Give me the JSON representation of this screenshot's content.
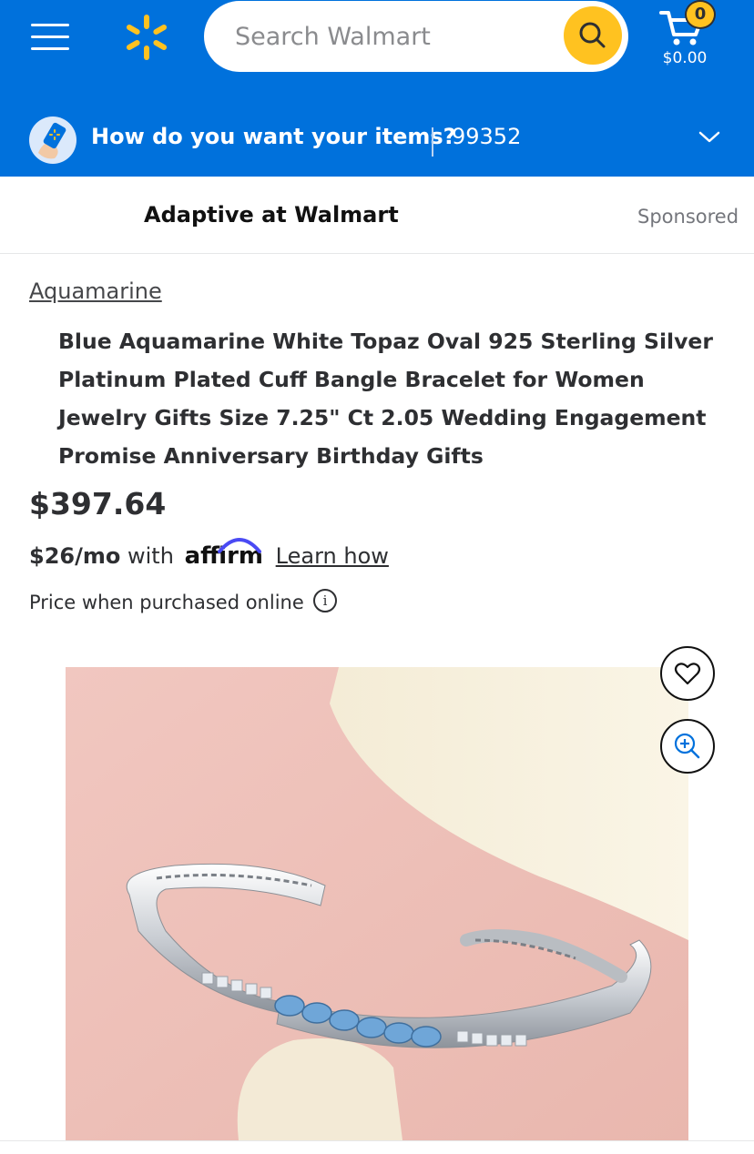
{
  "header": {
    "search_placeholder": "Search Walmart",
    "cart_count": "0",
    "cart_total": "$0.00",
    "brand_color": "#0071dc",
    "accent_color": "#ffc220",
    "icons": [
      "menu-icon",
      "walmart-spark-icon",
      "search-icon",
      "cart-icon"
    ]
  },
  "delivery": {
    "question": "How do you want your items?",
    "zip": "99352",
    "icons": [
      "phone-hand-icon",
      "chevron-down-icon"
    ]
  },
  "sponsored": {
    "title": "Adaptive at Walmart",
    "tag": "Sponsored"
  },
  "product": {
    "category": "Aquamarine",
    "title": "Blue Aquamarine White Topaz Oval 925 Sterling Silver Platinum Plated Cuff Bangle Bracelet for Women Jewelry Gifts Size 7.25\" Ct 2.05 Wedding Engagement Promise Anniversary Birthday Gifts",
    "price": "$397.64",
    "monthly": "$26/mo",
    "with_text": "with",
    "affirm_brand": "affirm",
    "learn_link": "Learn how",
    "price_note": "Price when purchased online",
    "info_glyph": "i",
    "image_icons": [
      "heart-icon",
      "zoom-in-icon"
    ]
  }
}
